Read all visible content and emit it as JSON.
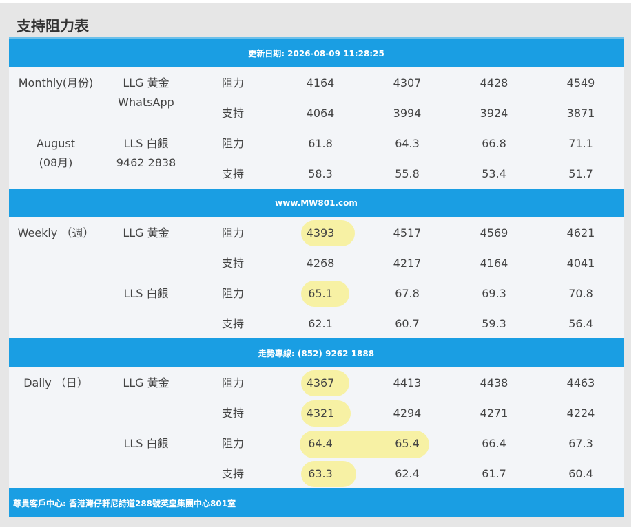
{
  "title": "支持阻力表",
  "header_band": "更新日期: 2026-08-09 11:28:25",
  "web_band": "www.MW801.com",
  "hotline_band": "走勢專線: (852) 9262 1888",
  "footer_band": "尊貴客戶中心: 香港灣仔軒尼詩道288號英皇集團中心801室",
  "labels": {
    "resistance": "阻力",
    "support": "支持"
  },
  "monthly": {
    "period_line1": "Monthly(月份)",
    "period_line2": "August",
    "period_line3": "(08月)",
    "gold_label": "LLG 黃金",
    "gold_sub": "WhatsApp",
    "silver_label": "LLS 白銀",
    "silver_sub": "9462 2838",
    "gold_resistance": [
      "4164",
      "4307",
      "4428",
      "4549"
    ],
    "gold_support": [
      "4064",
      "3994",
      "3924",
      "3871"
    ],
    "silver_resistance": [
      "61.8",
      "64.3",
      "66.8",
      "71.1"
    ],
    "silver_support": [
      "58.3",
      "55.8",
      "53.4",
      "51.7"
    ]
  },
  "weekly": {
    "period": "Weekly （週）",
    "gold_label": "LLG 黃金",
    "silver_label": "LLS 白銀",
    "gold_resistance": [
      "4393",
      "4517",
      "4569",
      "4621"
    ],
    "gold_support": [
      "4268",
      "4217",
      "4164",
      "4041"
    ],
    "silver_resistance": [
      "65.1",
      "67.8",
      "69.3",
      "70.8"
    ],
    "silver_support": [
      "62.1",
      "60.7",
      "59.3",
      "56.4"
    ]
  },
  "daily": {
    "period": "Daily （日）",
    "gold_label": "LLG 黃金",
    "silver_label": "LLS 白銀",
    "gold_resistance": [
      "4367",
      "4413",
      "4438",
      "4463"
    ],
    "gold_support": [
      "4321",
      "4294",
      "4271",
      "4224"
    ],
    "silver_resistance": [
      "64.4",
      "65.4",
      "66.4",
      "67.3"
    ],
    "silver_support": [
      "63.3",
      "62.4",
      "61.7",
      "60.4"
    ]
  },
  "highlight_color": "#f7f19a",
  "band_color": "#1a9ee3"
}
